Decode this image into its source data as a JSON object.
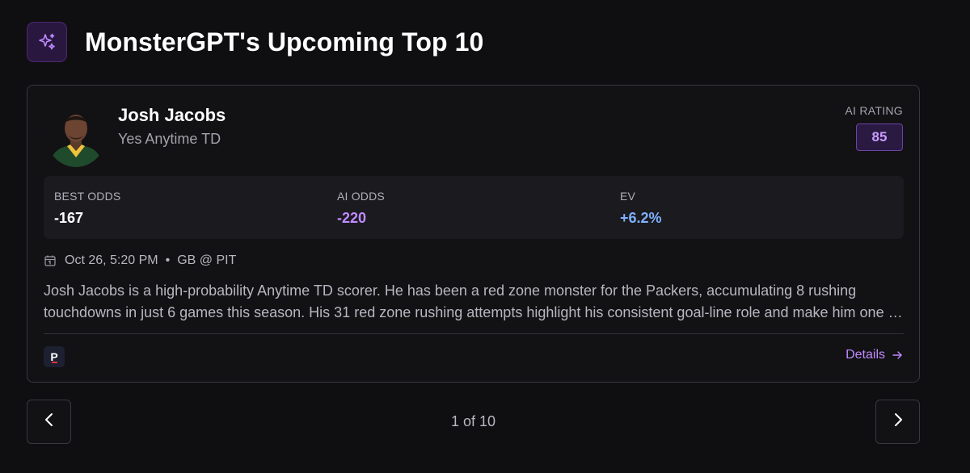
{
  "header": {
    "title": "MonsterGPT's Upcoming Top 10",
    "icon": "sparkles-icon"
  },
  "pick": {
    "player_name": "Josh Jacobs",
    "pick_label": "Yes Anytime TD",
    "ai_rating_label": "AI RATING",
    "ai_rating_value": "85",
    "odds": {
      "best_label": "BEST ODDS",
      "best_value": "-167",
      "ai_label": "AI ODDS",
      "ai_value": "-220",
      "ev_label": "EV",
      "ev_value": "+6.2%"
    },
    "date": "Oct 26, 5:20 PM",
    "separator": "•",
    "matchup": "GB @ PIT",
    "description": "Josh Jacobs is a high-probability Anytime TD scorer. He has been a red zone monster for the Packers, accumulating 8 rushing touchdowns in just 6 games this season. His 31 red zone rushing attempts highlight his consistent goal-line role and make him one of the most reliable touchdown threats this week.",
    "sportsbook_letter": "P",
    "details_label": "Details"
  },
  "pagination": {
    "indicator": "1 of 10"
  },
  "colors": {
    "accent_purple": "#c08bff",
    "ev_blue": "#7fb1ff",
    "background": "#0f0e11"
  }
}
